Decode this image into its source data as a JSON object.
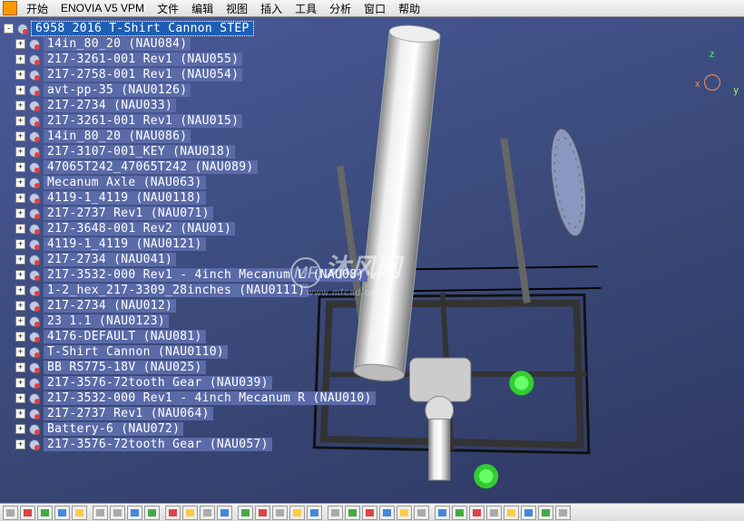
{
  "menu": {
    "start": "开始",
    "enovia": "ENOVIA V5 VPM",
    "file": "文件",
    "edit": "编辑",
    "view": "视图",
    "insert": "插入",
    "tools": "工具",
    "analyze": "分析",
    "window": "窗口",
    "help": "帮助"
  },
  "tree": {
    "root": "6958 2016 T-Shirt Cannon STEP",
    "items": [
      "14in_80_20 (NAU084)",
      "217-3261-001 Rev1 (NAU055)",
      "217-2758-001 Rev1 (NAU054)",
      "avt-pp-35 (NAU0126)",
      "217-2734 (NAU033)",
      "217-3261-001 Rev1 (NAU015)",
      "14in_80_20 (NAU086)",
      "217-3107-001_KEY (NAU018)",
      "47065T242_47065T242 (NAU089)",
      "Mecanum Axle (NAU063)",
      "4119-1_4119 (NAU0118)",
      "217-2737 Rev1 (NAU071)",
      "217-3648-001 Rev2 (NAU01)",
      "4119-1_4119 (NAU0121)",
      "217-2734 (NAU041)",
      "217-3532-000 Rev1 - 4inch Mecanum L (NAU08)",
      "1-2_hex_217-3309_28inches (NAU0111)",
      "217-2734 (NAU012)",
      "23 1.1 (NAU0123)",
      "4176-DEFAULT (NAU081)",
      "T-Shirt Cannon (NAU0110)",
      "BB RS775-18V (NAU025)",
      "217-3576-72tooth Gear (NAU039)",
      "217-3532-000 Rev1 - 4inch Mecanum R (NAU010)",
      "217-2737 Rev1 (NAU064)",
      "Battery-6 (NAU072)",
      "217-3576-72tooth Gear (NAU057)"
    ]
  },
  "compass": {
    "z": "z",
    "y": "y",
    "x": "x"
  },
  "watermark": {
    "logo": "MF",
    "text": "沐风网",
    "url": "www.mfcad.com"
  }
}
